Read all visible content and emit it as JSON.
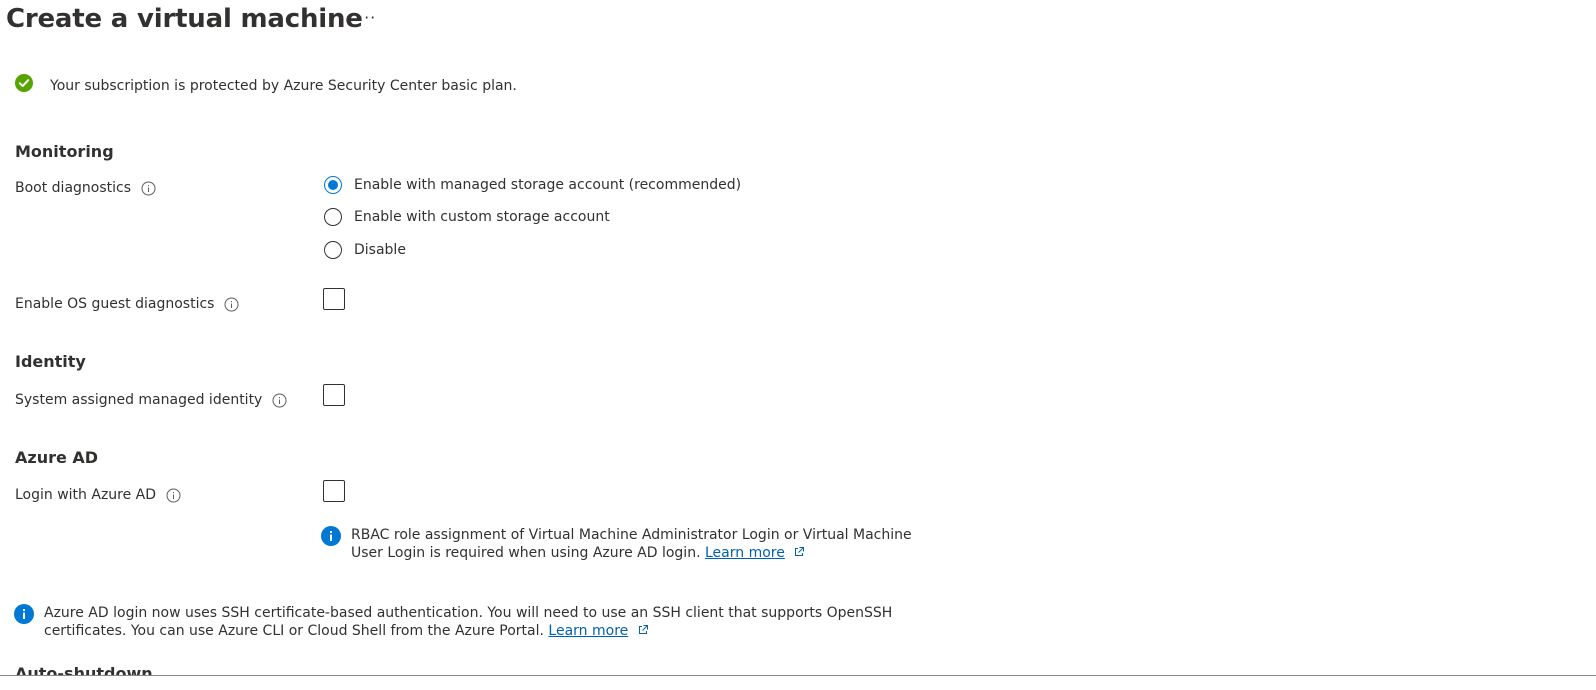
{
  "header": {
    "title": "Create a virtual machine",
    "more_label": "···"
  },
  "banner": {
    "text": "Your subscription is protected by Azure Security Center basic plan.",
    "icon": "check-circle-icon",
    "color": "#57a300"
  },
  "monitoring": {
    "heading": "Monitoring",
    "boot_diagnostics": {
      "label": "Boot diagnostics",
      "options": [
        {
          "label": "Enable with managed storage account (recommended)",
          "selected": true
        },
        {
          "label": "Enable with custom storage account",
          "selected": false
        },
        {
          "label": "Disable",
          "selected": false
        }
      ]
    },
    "os_guest_diagnostics": {
      "label": "Enable OS guest diagnostics",
      "checked": false
    }
  },
  "identity": {
    "heading": "Identity",
    "system_assigned": {
      "label": "System assigned managed identity",
      "checked": false
    }
  },
  "azure_ad": {
    "heading": "Azure AD",
    "login": {
      "label": "Login with Azure AD",
      "checked": false
    },
    "rbac_info": {
      "line1": "RBAC role assignment of Virtual Machine Administrator Login or Virtual Machine",
      "line2": "User Login is required when using Azure AD login.",
      "link": "Learn more"
    }
  },
  "ssh_info": {
    "line1": "Azure AD login now uses SSH certificate-based authentication. You will need to use an SSH client that supports OpenSSH",
    "line2": "certificates. You can use Azure CLI or Cloud Shell from the Azure Portal.",
    "link": "Learn more"
  },
  "next_section": {
    "heading": "Auto-shutdown"
  },
  "colors": {
    "accent": "#0078d4",
    "link": "#0062ad",
    "success": "#57a300",
    "info": "#0078d4"
  }
}
